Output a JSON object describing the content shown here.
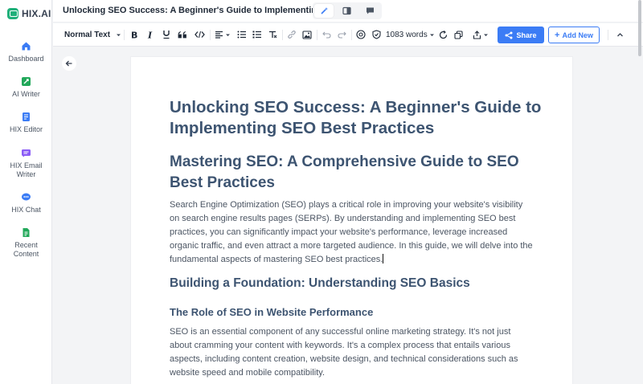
{
  "brand": {
    "name": "HIX.AI",
    "color": "#20b07a"
  },
  "sidebar": {
    "items": [
      {
        "label": "Dashboard",
        "icon": "home-icon",
        "color": "#3b7cf5"
      },
      {
        "label": "AI Writer",
        "icon": "ai-writer-icon",
        "color": "#22a85a"
      },
      {
        "label": "HIX Editor",
        "icon": "editor-icon",
        "color": "#3b7cf5"
      },
      {
        "label": "HIX Email Writer",
        "icon": "email-icon",
        "color": "#8b5cf6"
      },
      {
        "label": "HIX Chat",
        "icon": "chat-icon",
        "color": "#3b7cf5"
      },
      {
        "label": "Recent Content",
        "icon": "document-icon",
        "color": "#22a85a"
      }
    ]
  },
  "topbar": {
    "title": "Unlocking SEO Success: A Beginner's Guide to Implementin..."
  },
  "toolbar": {
    "style_select": "Normal Text",
    "word_count": "1083 words",
    "share_label": "Share",
    "add_new_label": "Add New",
    "accent": "#3b7cf5"
  },
  "document": {
    "title": "Unlocking SEO Success: A Beginner's Guide to Implementing SEO Best Practices",
    "heading_2": "Mastering SEO: A Comprehensive Guide to SEO Best Practices",
    "paragraph_1": "Search Engine Optimization (SEO) plays a critical role in improving your website's visibility on search engine results pages (SERPs). By understanding and implementing SEO best practices, you can significantly impact your website's performance, leverage increased organic traffic, and even attract a more targeted audience. In this guide, we will delve into the fundamental aspects of mastering SEO best practices.",
    "heading_3": "Building a Foundation: Understanding SEO Basics",
    "heading_4": "The Role of SEO in Website Performance",
    "paragraph_2": "SEO is an essential component of any successful online marketing strategy. It's not just about cramming your content with keywords. It's a complex process that entails various aspects, including content creation, website design, and technical considerations such as website speed and mobile compatibility."
  }
}
